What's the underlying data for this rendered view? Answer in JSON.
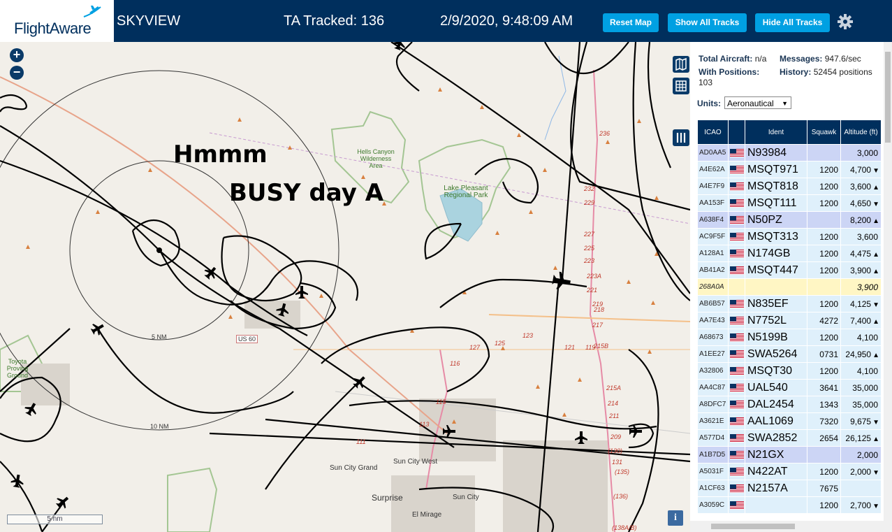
{
  "header": {
    "logo_text": "FlightAware",
    "app_title": "SKYVIEW",
    "tracked": "TA Tracked: 136",
    "datetime": "2/9/2020, 9:48:09 AM",
    "buttons": {
      "reset_map": "Reset Map",
      "show_all_tracks": "Show All Tracks",
      "hide_all_tracks": "Hide All Tracks"
    }
  },
  "map": {
    "zoom_in": "+",
    "zoom_out": "−",
    "annotation_line1": "Hmmm",
    "annotation_line2": "BUSY day A",
    "ring_labels": [
      "5 NM",
      "10 NM"
    ],
    "scale_label": "5 nm",
    "info_label": "i",
    "places": {
      "hells_canyon": "Hells Canyon Wilderness Area",
      "lake_pleasant": "Lake Pleasant Regional Park",
      "sun_city_grand": "Sun City Grand",
      "sun_city_west": "Sun City West",
      "surprise": "Surprise",
      "sun_city": "Sun City",
      "el_mirage": "El Mirage",
      "toyota": "Toyota Proving Ground",
      "us60": "US 60"
    },
    "road_numbers": [
      "236",
      "232",
      "229",
      "227",
      "225",
      "223",
      "223A",
      "221",
      "219",
      "218",
      "217",
      "215B",
      "215A",
      "214",
      "211",
      "209",
      "(130)",
      "131",
      "(135)",
      "(136)",
      "(138A/B)",
      "127",
      "125",
      "123",
      "121",
      "119",
      "116",
      "115",
      "113",
      "111"
    ]
  },
  "sidebar": {
    "total_aircraft_label": "Total Aircraft:",
    "total_aircraft_value": "n/a",
    "messages_label": "Messages:",
    "messages_value": "947.6/sec",
    "with_positions_label": "With Positions:",
    "with_positions_value": "103",
    "history_label": "History:",
    "history_value": "52454 positions",
    "units_label": "Units:",
    "units_value": "Aeronautical",
    "columns": [
      "ICAO",
      "",
      "Ident",
      "Squawk",
      "Altitude (ft)"
    ],
    "rows": [
      {
        "icao": "AD0AA5",
        "ident": "N93984",
        "squawk": "",
        "alt": "3,000",
        "trend": "",
        "style": "sel"
      },
      {
        "icao": "A4E62A",
        "ident": "MSQT971",
        "squawk": "1200",
        "alt": "4,700",
        "trend": "▼",
        "style": ""
      },
      {
        "icao": "A4E7F9",
        "ident": "MSQT818",
        "squawk": "1200",
        "alt": "3,600",
        "trend": "▲",
        "style": ""
      },
      {
        "icao": "AA153F",
        "ident": "MSQT111",
        "squawk": "1200",
        "alt": "4,650",
        "trend": "▼",
        "style": ""
      },
      {
        "icao": "A638F4",
        "ident": "N50PZ",
        "squawk": "",
        "alt": "8,200",
        "trend": "▲",
        "style": "sel"
      },
      {
        "icao": "AC9F5F",
        "ident": "MSQT313",
        "squawk": "1200",
        "alt": "3,600",
        "trend": "",
        "style": ""
      },
      {
        "icao": "A128A1",
        "ident": "N174GB",
        "squawk": "1200",
        "alt": "4,475",
        "trend": "▲",
        "style": ""
      },
      {
        "icao": "AB41A2",
        "ident": "MSQT447",
        "squawk": "1200",
        "alt": "3,900",
        "trend": "▲",
        "style": ""
      },
      {
        "icao": "268A0A",
        "ident": "",
        "squawk": "",
        "alt": "3,900",
        "trend": "",
        "style": "yellow",
        "noflag": true
      },
      {
        "icao": "AB6B57",
        "ident": "N835EF",
        "squawk": "1200",
        "alt": "4,125",
        "trend": "▼",
        "style": ""
      },
      {
        "icao": "AA7E43",
        "ident": "N7752L",
        "squawk": "4272",
        "alt": "7,400",
        "trend": "▲",
        "style": ""
      },
      {
        "icao": "A68673",
        "ident": "N5199B",
        "squawk": "1200",
        "alt": "4,100",
        "trend": "",
        "style": ""
      },
      {
        "icao": "A1EE27",
        "ident": "SWA5264",
        "squawk": "0731",
        "alt": "24,950",
        "trend": "▲",
        "style": ""
      },
      {
        "icao": "A32806",
        "ident": "MSQT30",
        "squawk": "1200",
        "alt": "4,100",
        "trend": "",
        "style": ""
      },
      {
        "icao": "AA4C87",
        "ident": "UAL540",
        "squawk": "3641",
        "alt": "35,000",
        "trend": "",
        "style": ""
      },
      {
        "icao": "A8DFC7",
        "ident": "DAL2454",
        "squawk": "1343",
        "alt": "35,000",
        "trend": "",
        "style": ""
      },
      {
        "icao": "A3621E",
        "ident": "AAL1069",
        "squawk": "7320",
        "alt": "9,675",
        "trend": "▼",
        "style": ""
      },
      {
        "icao": "A577D4",
        "ident": "SWA2852",
        "squawk": "2654",
        "alt": "26,125",
        "trend": "▲",
        "style": ""
      },
      {
        "icao": "A1B7D5",
        "ident": "N21GX",
        "squawk": "",
        "alt": "2,000",
        "trend": "",
        "style": "sel"
      },
      {
        "icao": "A5031F",
        "ident": "N422AT",
        "squawk": "1200",
        "alt": "2,000",
        "trend": "▼",
        "style": ""
      },
      {
        "icao": "A1CF63",
        "ident": "N2157A",
        "squawk": "7675",
        "alt": "",
        "trend": "",
        "style": ""
      },
      {
        "icao": "A3059C",
        "ident": "",
        "squawk": "1200",
        "alt": "2,700",
        "trend": "▼",
        "style": ""
      }
    ]
  },
  "colors": {
    "header_bg": "#002f5d",
    "button_bg": "#00a0e2",
    "selected_row": "#ccd5f5",
    "row_bg": "#dff0fb",
    "yellow_row": "#fff6c4"
  },
  "icons": [
    "gear-icon",
    "map-icon",
    "grid-icon",
    "columns-icon",
    "airplane-icon",
    "flag-icon"
  ]
}
